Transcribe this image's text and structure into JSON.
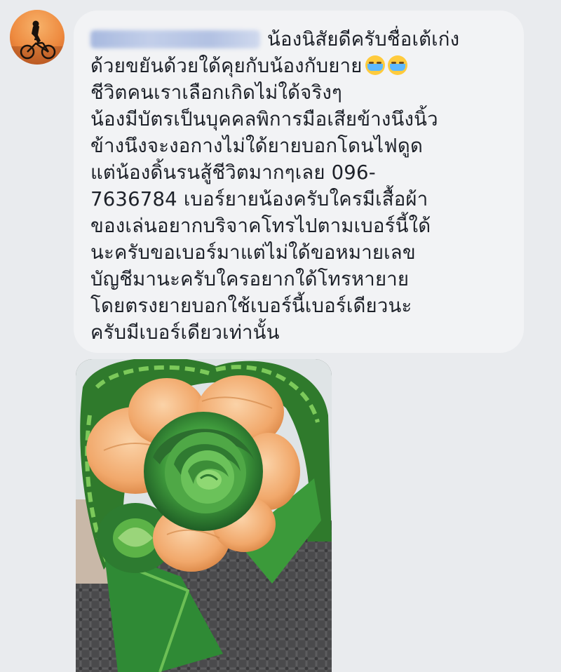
{
  "comment": {
    "author_avatar_icon": "cyclist-silhouette-icon",
    "author_name_blurred": true,
    "lines": [
      "น้องนิสัยดีครับชื่อเต้เก่ง",
      "ด้วยขยันด้วยใด้คุยกับน้องกับยาย",
      "ชีวิตคนเราเลือกเกิดไม่ใด้จริงๆ",
      "น้องมีบัตรเป็นบุคคลพิการมือเสียข้างนึงนิ้ว",
      "ข้างนึงจะงอกางไม่ใด้ยายบอกโดนไฟดูด",
      "แต่น้องดิ้นรนสู้ชีวิตมากๆเลย 096-",
      "7636784 เบอร์ยายน้องครับใครมีเสื้อผ้า",
      "ของเล่นอยากบริจาคโทรไปตามเบอร์นี้ใด้",
      "นะครับขอเบอร์มาแต่ไม่ใด้ขอหมายเลข",
      "บัญชีมานะครับใครอยากใด้โทรหายาย",
      "โดยตรงยายบอกใช้เบอร์นี้เบอร์เดียวนะ",
      "ครับมีเบอร์เดียวเท่านั้น"
    ],
    "emojis": [
      "loudly-crying-face-icon",
      "loudly-crying-face-icon"
    ]
  },
  "attachment": {
    "type": "photo",
    "subject": "woven green leaf rose with orange bougainvillea petals"
  },
  "colors": {
    "page_bg": "#e9ebee",
    "bubble_bg": "#f2f3f5",
    "text": "#1d2129"
  }
}
